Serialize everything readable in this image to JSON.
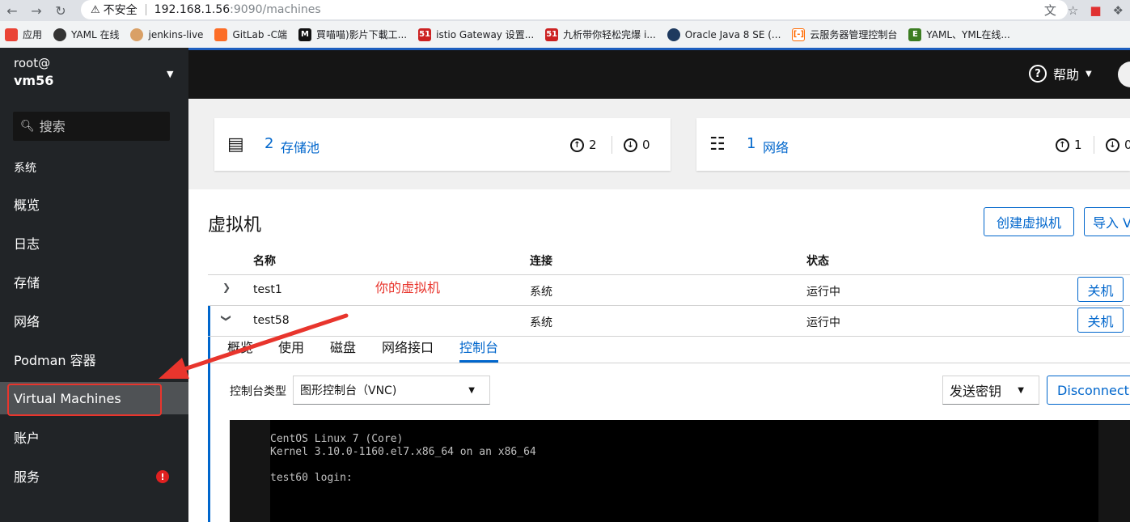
{
  "browser": {
    "security_text": "不安全",
    "url_host": "192.168.1.56",
    "url_path": ":9090/machines",
    "bookmarks": [
      {
        "label": "应用",
        "color": "#4285f4"
      },
      {
        "label": "YAML 在线",
        "color": "#333333"
      },
      {
        "label": "jenkins-live",
        "color": "#d33833"
      },
      {
        "label": "GitLab -C端",
        "color": "#fc6d26"
      },
      {
        "label": "買喵喵)影片下載工...",
        "color": "#111111"
      },
      {
        "label": "istio Gateway 设置...",
        "color": "#cc2222"
      },
      {
        "label": "九析带你轻松完爆 i...",
        "color": "#cc2222"
      },
      {
        "label": "Oracle Java 8 SE (...",
        "color": "#1e3a5f"
      },
      {
        "label": "云服务器管理控制台",
        "color": "#ff6a00"
      },
      {
        "label": "YAML、YML在线...",
        "color": "#3c7d22"
      }
    ]
  },
  "sidebar": {
    "user": "root@",
    "host": "vm56",
    "search_placeholder": "搜索",
    "section": "系统",
    "items": [
      {
        "label": "概览"
      },
      {
        "label": "日志"
      },
      {
        "label": "存储"
      },
      {
        "label": "网络"
      },
      {
        "label": "Podman 容器"
      },
      {
        "label": "Virtual Machines"
      },
      {
        "label": "账户"
      },
      {
        "label": "服务"
      }
    ],
    "alert_icon": "!"
  },
  "topbar": {
    "help_label": "帮助"
  },
  "cards": [
    {
      "count": "2",
      "label": "存储池",
      "up": "2",
      "down": "0",
      "icon": "storage-icon"
    },
    {
      "count": "1",
      "label": "网络",
      "up": "1",
      "down": "0",
      "icon": "network-icon"
    }
  ],
  "vm": {
    "title": "虚拟机",
    "create_button": "创建虚拟机",
    "import_button": "导入 V",
    "columns": [
      "名称",
      "连接",
      "状态"
    ],
    "rows": [
      {
        "name": "test1",
        "connection": "系统",
        "state": "运行中",
        "action": "关机"
      },
      {
        "name": "test58",
        "connection": "系统",
        "state": "运行中",
        "action": "关机"
      }
    ],
    "annotation": "你的虚拟机",
    "tabs": [
      "概览",
      "使用",
      "磁盘",
      "网络接口",
      "控制台"
    ],
    "console_type_label": "控制台类型",
    "console_type_value": "图形控制台（VNC)",
    "send_key_label": "发送密钥",
    "disconnect_label": "Disconnect",
    "console_text": "CentOS Linux 7 (Core)\nKernel 3.10.0-1160.el7.x86_64 on an x86_64\n\ntest60 login:"
  }
}
